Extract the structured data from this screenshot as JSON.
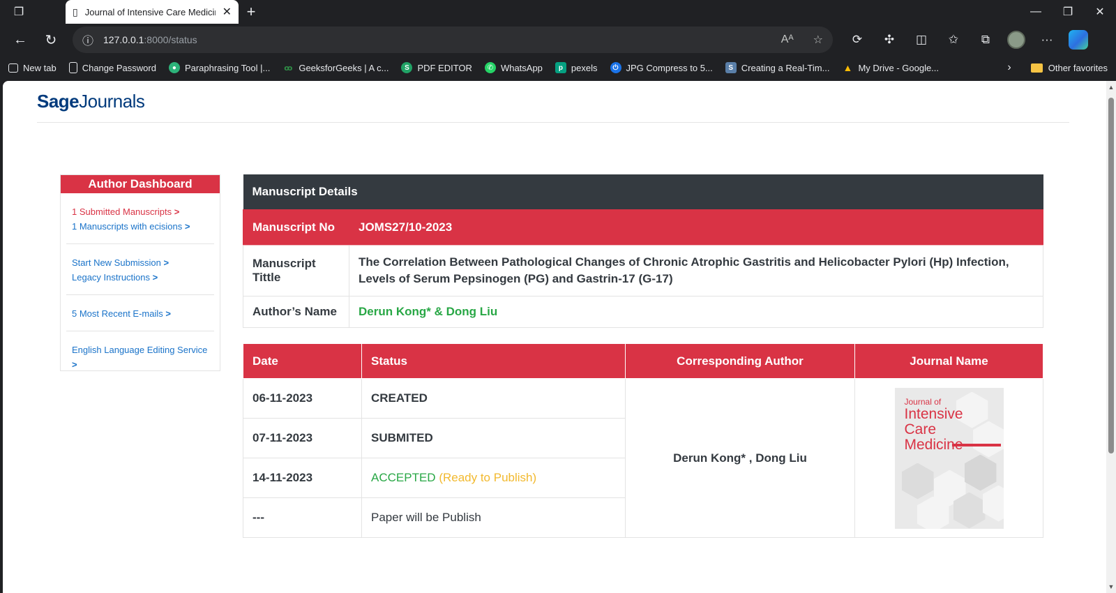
{
  "browser": {
    "tab_title": "Journal of Intensive Care Medicine",
    "url_host": "127.0.0.1",
    "url_rest": ":8000/status",
    "bookmarks": [
      {
        "label": "New tab",
        "color": "#e8eaed"
      },
      {
        "label": "Change Password",
        "color": "#e8eaed"
      },
      {
        "label": "Paraphrasing Tool |...",
        "color": "#2db37a"
      },
      {
        "label": "GeeksforGeeks | A c...",
        "color": "#2f8d46"
      },
      {
        "label": "PDF EDITOR",
        "color": "#21a366"
      },
      {
        "label": "WhatsApp",
        "color": "#25d366"
      },
      {
        "label": "pexels",
        "color": "#05a081"
      },
      {
        "label": "JPG Compress to 5...",
        "color": "#1a73e8"
      },
      {
        "label": "Creating a Real-Tim...",
        "color": "#5a7fa8"
      },
      {
        "label": "My Drive - Google...",
        "color": "#fbbc04"
      }
    ],
    "other_favorites": "Other favorites"
  },
  "site": {
    "logo_bold": "Sage",
    "logo_rest": "Journals"
  },
  "sidebar": {
    "title": "Author Dashboard",
    "group1": [
      "1 Submitted Manuscripts",
      "1 Manuscripts with ecisions"
    ],
    "group2": [
      "Start New Submission",
      "Legacy Instructions"
    ],
    "group3": [
      "5 Most Recent E-mails"
    ],
    "group4": [
      "English Language Editing Service"
    ],
    "arrow": ">"
  },
  "details": {
    "header": "Manuscript Details",
    "no_label": "Manuscript No",
    "no_value": "JOMS27/10-2023",
    "title_label": "Manuscript Tittle",
    "title_value": "The Correlation Between Pathological Changes of Chronic Atrophic Gastritis and Helicobacter Pylori (Hp) Infection, Levels of Serum Pepsinogen (PG) and Gastrin-17 (G-17)",
    "author_label": "Author’s Name",
    "author_value": "Derun Kong* & Dong Liu"
  },
  "status": {
    "columns": [
      "Date",
      "Status",
      "Corresponding Author",
      "Journal Name"
    ],
    "rows": [
      {
        "date": "06-11-2023",
        "status": "CREATED"
      },
      {
        "date": "07-11-2023",
        "status": "SUBMITED"
      },
      {
        "date": "14-11-2023",
        "status": "ACCEPTED",
        "status_note": "(Ready to Publish)"
      },
      {
        "date": "---",
        "status": "Paper will be Publish"
      }
    ],
    "corresponding_author": "Derun Kong* , Dong Liu",
    "cover": {
      "line1": "Journal of",
      "line2": "Intensive",
      "line3": "Care",
      "line4": "Medicine"
    }
  },
  "colors": {
    "accent_red": "#d93345",
    "dark_header": "#343a40",
    "link_blue": "#1a73c9",
    "green": "#28a745",
    "yellow": "#f2b92e"
  }
}
